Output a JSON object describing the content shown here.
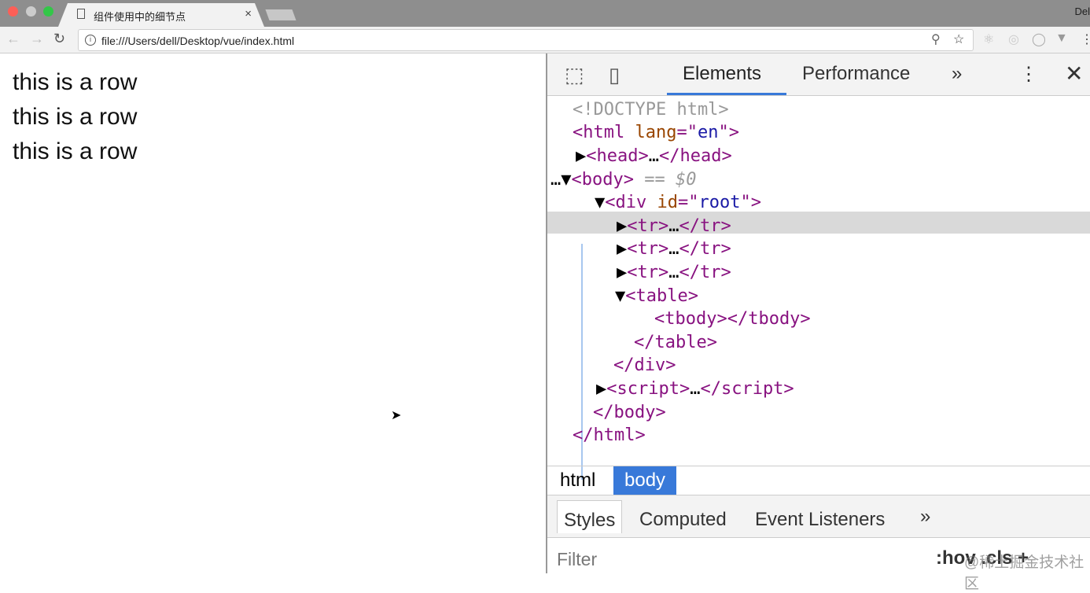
{
  "browser": {
    "tab_title": "组件使用中的细节点",
    "profile": "Del",
    "url": "file:///Users/dell/Desktop/vue/index.html"
  },
  "page": {
    "rows": [
      "this is a row",
      "this is a row",
      "this is a row"
    ]
  },
  "devtools": {
    "tabs": [
      "Elements",
      "Performance"
    ],
    "more": "»",
    "tree": {
      "doctype": "<!DOCTYPE html>",
      "selected_suffix": " == $0"
    },
    "breadcrumbs": [
      "html",
      "body"
    ],
    "style_tabs": [
      "Styles",
      "Computed",
      "Event Listeners"
    ],
    "filter_placeholder": "Filter",
    "hov_cls": ":hov .cls +"
  },
  "watermark": "@稀土掘金技术社区",
  "colors": {
    "accent": "#3879d9",
    "tag": "#881280",
    "attr": "#994500",
    "value": "#1a1aa6"
  }
}
